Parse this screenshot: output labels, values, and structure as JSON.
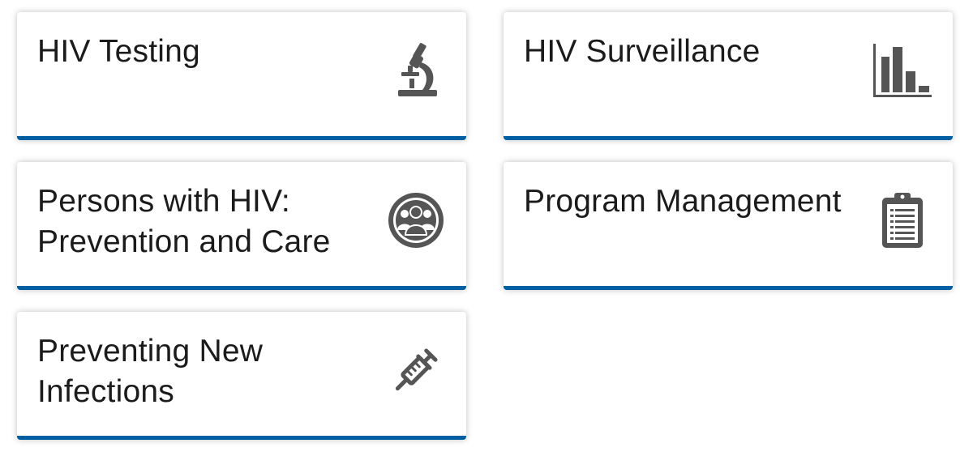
{
  "accent_color": "#005ea2",
  "icon_color": "#555555",
  "cards": [
    {
      "label": "HIV Testing",
      "icon": "microscope-icon"
    },
    {
      "label": "HIV Surveillance",
      "icon": "bar-chart-icon"
    },
    {
      "label": "Persons with HIV: Prevention and Care",
      "icon": "people-group-icon"
    },
    {
      "label": "Program Management",
      "icon": "clipboard-icon"
    },
    {
      "label": "Preventing New Infections",
      "icon": "syringe-icon"
    }
  ]
}
